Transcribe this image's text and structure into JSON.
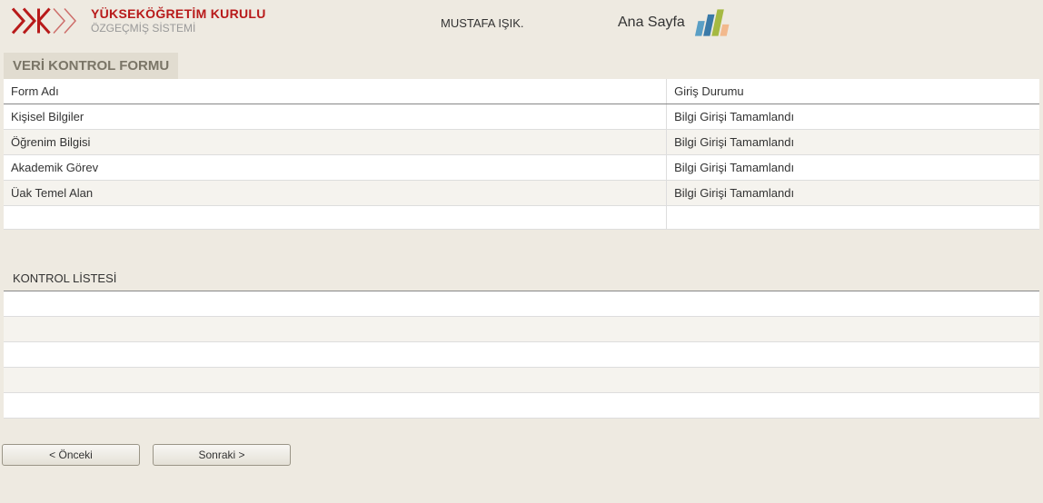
{
  "header": {
    "org_title": "YÜKSEKÖĞRETİM KURULU",
    "org_sub": "ÖZGEÇMİŞ SİSTEMİ",
    "user": "MUSTAFA IŞIK.",
    "home_label": "Ana Sayfa"
  },
  "section1": {
    "title": "VERİ  KONTROL FORMU",
    "columns": {
      "name": "Form Adı",
      "status": "Giriş Durumu"
    },
    "rows": [
      {
        "name": "Kişisel Bilgiler",
        "status": "Bilgi Girişi   Tamamlandı"
      },
      {
        "name": "Öğrenim Bilgisi",
        "status": "Bilgi Girişi   Tamamlandı"
      },
      {
        "name": "Akademik Görev",
        "status": "Bilgi Girişi   Tamamlandı"
      },
      {
        "name": "Üak Temel   Alan",
        "status": "Bilgi Girişi   Tamamlandı"
      }
    ]
  },
  "section2": {
    "title": "KONTROL LİSTESİ"
  },
  "buttons": {
    "prev": "< Önceki",
    "next": "Sonraki >"
  }
}
